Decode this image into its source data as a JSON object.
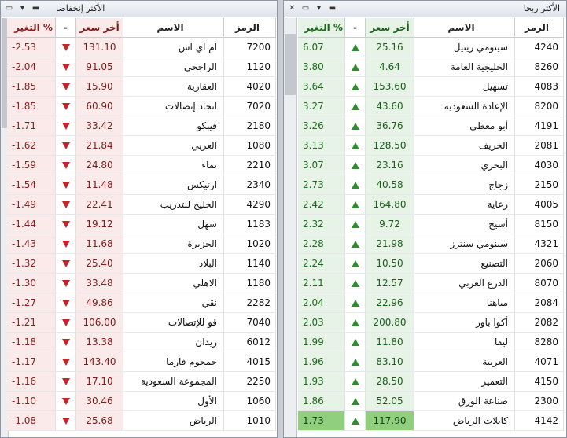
{
  "losers": {
    "title": "الأكثر إنخفاضا",
    "headers": {
      "change": "التغير %",
      "arrow": "-",
      "price": "أخر سعر",
      "name": "الاسم",
      "symbol": "الرمز"
    },
    "rows": [
      {
        "change": "-2.53",
        "price": "131.10",
        "name": "ام آي اس",
        "symbol": "7200"
      },
      {
        "change": "-2.04",
        "price": "91.05",
        "name": "الراجحي",
        "symbol": "1120"
      },
      {
        "change": "-1.85",
        "price": "15.90",
        "name": "العقارية",
        "symbol": "4020"
      },
      {
        "change": "-1.85",
        "price": "60.90",
        "name": "اتحاد إتصالات",
        "symbol": "7020"
      },
      {
        "change": "-1.71",
        "price": "33.42",
        "name": "فيبكو",
        "symbol": "2180"
      },
      {
        "change": "-1.62",
        "price": "21.84",
        "name": "العربي",
        "symbol": "1080"
      },
      {
        "change": "-1.59",
        "price": "24.80",
        "name": "نماء",
        "symbol": "2210"
      },
      {
        "change": "-1.54",
        "price": "11.48",
        "name": "ارتيكس",
        "symbol": "2340"
      },
      {
        "change": "-1.49",
        "price": "22.41",
        "name": "الخليج للتدريب",
        "symbol": "4290"
      },
      {
        "change": "-1.44",
        "price": "19.12",
        "name": "سهل",
        "symbol": "1183"
      },
      {
        "change": "-1.43",
        "price": "11.68",
        "name": "الجزيرة",
        "symbol": "1020"
      },
      {
        "change": "-1.32",
        "price": "25.40",
        "name": "البلاد",
        "symbol": "1140"
      },
      {
        "change": "-1.30",
        "price": "33.48",
        "name": "الاهلي",
        "symbol": "1180"
      },
      {
        "change": "-1.27",
        "price": "49.86",
        "name": "نقي",
        "symbol": "2282"
      },
      {
        "change": "-1.21",
        "price": "106.00",
        "name": "قو للإتصالات",
        "symbol": "7040"
      },
      {
        "change": "-1.18",
        "price": "13.38",
        "name": "ريدان",
        "symbol": "6012"
      },
      {
        "change": "-1.17",
        "price": "143.40",
        "name": "جمجوم فارما",
        "symbol": "4015"
      },
      {
        "change": "-1.16",
        "price": "17.10",
        "name": "المجموعة السعودية",
        "symbol": "2250"
      },
      {
        "change": "-1.10",
        "price": "30.46",
        "name": "الأول",
        "symbol": "1060"
      },
      {
        "change": "-1.08",
        "price": "25.68",
        "name": "الرياض",
        "symbol": "1010"
      }
    ]
  },
  "gainers": {
    "title": "الأكثر ربحا",
    "headers": {
      "change": "التغير %",
      "arrow": "-",
      "price": "أخر سعر",
      "name": "الاسم",
      "symbol": "الرمز"
    },
    "rows": [
      {
        "change": "6.07",
        "price": "25.16",
        "name": "سينومي ريتيل",
        "symbol": "4240"
      },
      {
        "change": "3.80",
        "price": "4.64",
        "name": "الخليجية العامة",
        "symbol": "8260"
      },
      {
        "change": "3.64",
        "price": "153.60",
        "name": "تسهيل",
        "symbol": "4083"
      },
      {
        "change": "3.27",
        "price": "43.60",
        "name": "الإعادة السعودية",
        "symbol": "8200"
      },
      {
        "change": "3.26",
        "price": "36.76",
        "name": "أبو معطي",
        "symbol": "4191"
      },
      {
        "change": "3.13",
        "price": "128.50",
        "name": "الخريف",
        "symbol": "2081"
      },
      {
        "change": "3.07",
        "price": "23.16",
        "name": "البحري",
        "symbol": "4030"
      },
      {
        "change": "2.73",
        "price": "40.58",
        "name": "زجاج",
        "symbol": "2150"
      },
      {
        "change": "2.42",
        "price": "164.80",
        "name": "رعاية",
        "symbol": "4005"
      },
      {
        "change": "2.32",
        "price": "9.72",
        "name": "أسيج",
        "symbol": "8150"
      },
      {
        "change": "2.28",
        "price": "21.98",
        "name": "سينومي سنترز",
        "symbol": "4321"
      },
      {
        "change": "2.24",
        "price": "10.50",
        "name": "التصنيع",
        "symbol": "2060"
      },
      {
        "change": "2.11",
        "price": "12.57",
        "name": "الدرع العربي",
        "symbol": "8070"
      },
      {
        "change": "2.04",
        "price": "22.96",
        "name": "مياهنا",
        "symbol": "2084"
      },
      {
        "change": "2.03",
        "price": "200.80",
        "name": "أكوا باور",
        "symbol": "2082"
      },
      {
        "change": "1.99",
        "price": "11.80",
        "name": "ليفا",
        "symbol": "8280"
      },
      {
        "change": "1.96",
        "price": "83.10",
        "name": "العربية",
        "symbol": "4071"
      },
      {
        "change": "1.93",
        "price": "28.50",
        "name": "التعمير",
        "symbol": "4150"
      },
      {
        "change": "1.86",
        "price": "52.05",
        "name": "صناعة الورق",
        "symbol": "2300"
      },
      {
        "change": "1.73",
        "price": "117.90",
        "name": "كابلات الرياض",
        "symbol": "4142"
      }
    ]
  },
  "titlebar_icons": [
    "close-icon",
    "restore-icon",
    "dropdown-icon",
    "minimize-icon"
  ],
  "colors": {
    "loss_bg": "#fbeaea",
    "loss_text": "#8a1f1f",
    "loss_arrow": "#c0262a",
    "gain_bg": "#e6f3e6",
    "gain_text": "#1b6a1b",
    "gain_arrow": "#2f8c2f",
    "highlight": "#8fcf7e"
  }
}
